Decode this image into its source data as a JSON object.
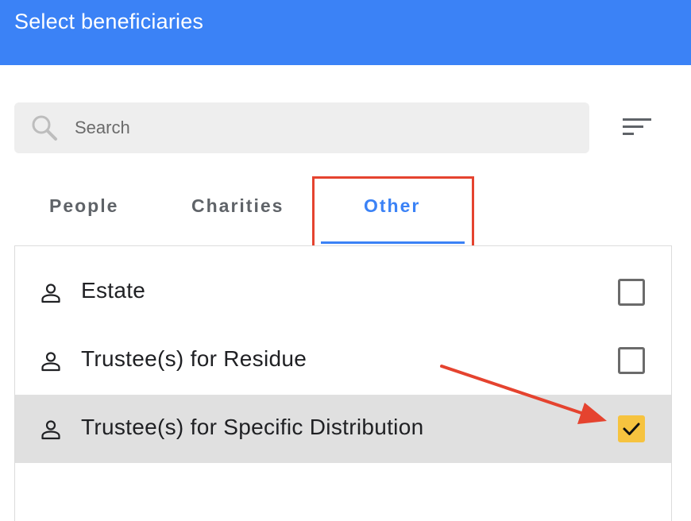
{
  "header": {
    "title": "Select beneficiaries"
  },
  "search": {
    "placeholder": "Search",
    "value": ""
  },
  "toolbar": {
    "sort_icon": "sort-icon"
  },
  "tabs": [
    {
      "label": "People",
      "active": false
    },
    {
      "label": "Charities",
      "active": false
    },
    {
      "label": "Other",
      "active": true
    }
  ],
  "list": {
    "items": [
      {
        "label": "Estate",
        "icon": "person-icon",
        "checked": false
      },
      {
        "label": "Trustee(s) for Residue",
        "icon": "person-icon",
        "checked": false
      },
      {
        "label": "Trustee(s) for Specific Distribution",
        "icon": "person-icon",
        "checked": true
      }
    ]
  },
  "colors": {
    "header": "#3b82f6",
    "accent": "#3b82f6",
    "annotation": "#e5432f",
    "checked_fill": "#f6c33f",
    "selected_row": "#e0e0e0"
  }
}
